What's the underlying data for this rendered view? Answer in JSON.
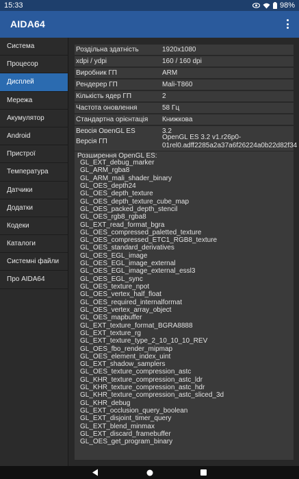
{
  "status_bar": {
    "time": "15:33",
    "battery": "98%",
    "icons": [
      "eye-icon",
      "wifi-icon",
      "battery-icon"
    ]
  },
  "app": {
    "title": "AIDA64",
    "menu_icon": "overflow-menu-icon"
  },
  "sidebar": {
    "items": [
      {
        "label": "Система"
      },
      {
        "label": "Процесор"
      },
      {
        "label": "Дисплей"
      },
      {
        "label": "Мережа"
      },
      {
        "label": "Акумулятор"
      },
      {
        "label": "Android"
      },
      {
        "label": "Пристрої"
      },
      {
        "label": "Температура"
      },
      {
        "label": "Датчики"
      },
      {
        "label": "Додатки"
      },
      {
        "label": "Кодеки"
      },
      {
        "label": "Каталоги"
      },
      {
        "label": "Системні файли"
      },
      {
        "label": "Про AIDA64"
      }
    ],
    "active": "Дисплей"
  },
  "display": {
    "rows": [
      {
        "key": "Роздільна здатність",
        "value": "1920x1080"
      },
      {
        "key": "xdpi / ydpi",
        "value": "160 / 160 dpi"
      },
      {
        "key": "Виробник ГП",
        "value": "ARM"
      },
      {
        "key": "Рендерер ГП",
        "value": "Mali-T860"
      },
      {
        "key": "Кількість ядер ГП",
        "value": "2"
      },
      {
        "key": "Частота оновлення",
        "value": "58 Гц"
      },
      {
        "key": "Стандартна орієнтація",
        "value": "Книжкова"
      },
      {
        "key": "Версія OpenGL ES",
        "value": "3.2"
      },
      {
        "key": "Версія ГП",
        "value": "OpenGL ES 3.2 v1.r26p0-01rel0.adff2285a2a37a6f26224a0b22d82f34"
      }
    ],
    "extensions_header": "Розширення OpenGL ES:",
    "extensions": [
      "GL_EXT_debug_marker",
      "GL_ARM_rgba8",
      "GL_ARM_mali_shader_binary",
      "GL_OES_depth24",
      "GL_OES_depth_texture",
      "GL_OES_depth_texture_cube_map",
      "GL_OES_packed_depth_stencil",
      "GL_OES_rgb8_rgba8",
      "GL_EXT_read_format_bgra",
      "GL_OES_compressed_paletted_texture",
      "GL_OES_compressed_ETC1_RGB8_texture",
      "GL_OES_standard_derivatives",
      "GL_OES_EGL_image",
      "GL_OES_EGL_image_external",
      "GL_OES_EGL_image_external_essl3",
      "GL_OES_EGL_sync",
      "GL_OES_texture_npot",
      "GL_OES_vertex_half_float",
      "GL_OES_required_internalformat",
      "GL_OES_vertex_array_object",
      "GL_OES_mapbuffer",
      "GL_EXT_texture_format_BGRA8888",
      "GL_EXT_texture_rg",
      "GL_EXT_texture_type_2_10_10_10_REV",
      "GL_OES_fbo_render_mipmap",
      "GL_OES_element_index_uint",
      "GL_EXT_shadow_samplers",
      "GL_OES_texture_compression_astc",
      "GL_KHR_texture_compression_astc_ldr",
      "GL_KHR_texture_compression_astc_hdr",
      "GL_KHR_texture_compression_astc_sliced_3d",
      "GL_KHR_debug",
      "GL_EXT_occlusion_query_boolean",
      "GL_EXT_disjoint_timer_query",
      "GL_EXT_blend_minmax",
      "GL_EXT_discard_framebuffer",
      "GL_OES_get_program_binary"
    ]
  },
  "nav_bar": {
    "icons": [
      "back-icon",
      "home-icon",
      "recents-icon"
    ]
  },
  "colors": {
    "status_bar": "#1e3f6c",
    "app_bar": "#2a5a9c",
    "active_item": "#2b6bb0",
    "background": "#282828",
    "row_background": "#3a3a3a"
  }
}
